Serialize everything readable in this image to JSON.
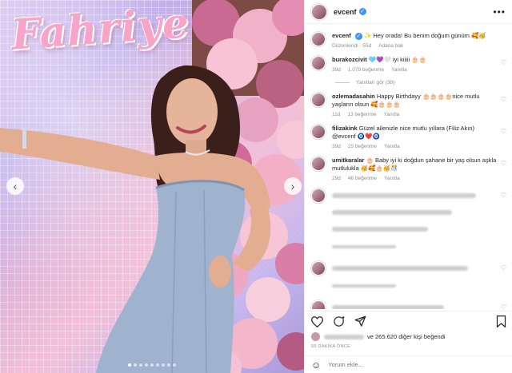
{
  "photo": {
    "sign_text": "Fahriye"
  },
  "post": {
    "username": "evcenf",
    "verified_glyph": "✓",
    "more_glyph": "•••"
  },
  "caption": {
    "username": "evcenf",
    "text": "✨ Hey orada! Bu benim doğum günüm 🥰🥳",
    "time": "55d",
    "see_translation": "Düzenlendi · 55d",
    "translate": "Adana bak"
  },
  "comments": [
    {
      "username": "burakozcivit",
      "text": "🩵💜🤍 iyi kiiiii 🎂🎂",
      "time": "39d",
      "likes": "1.079 beğenme",
      "reply": "Yanıtla",
      "view_replies": "Yanıtları gör (38)"
    },
    {
      "username": "ozlemadasahin",
      "text": "Happy Birthdayy 🎂🎂🎂🎂nice mutlu yaşların olsun 🥰🎂🎂🎂",
      "time": "11d",
      "likes": "13 beğenme",
      "reply": "Yanıtla"
    },
    {
      "username": "filizakink",
      "text": "Güzel ailenizle nice mutlu yıllara (Filiz Akın)",
      "mention": "@evcenf 🧿❤️🧿",
      "time": "39d",
      "likes": "25 beğenme",
      "reply": "Yanıtla"
    },
    {
      "username": "umitkaralar",
      "text": "🎂 Baby iyi ki doğdun şahane bir yaş olsun aşkla mutlulukla 🥳🥰🎂🥳🎊",
      "time": "29d",
      "likes": "46 beğenme",
      "reply": "Yanıtla"
    }
  ],
  "actions": {
    "like_icon": "heart-icon",
    "comment_icon": "comment-icon",
    "share_icon": "share-icon",
    "save_icon": "bookmark-icon"
  },
  "likes_summary": {
    "text_suffix": "ve 265.620 diğer kişi beğendi"
  },
  "time_ago": "59 DAKİKA ÖNCE",
  "add_comment": {
    "placeholder": "Yorum ekle..."
  },
  "colors": {
    "accent": "#3897f0",
    "text": "#262626",
    "muted": "#8e8e8e"
  }
}
